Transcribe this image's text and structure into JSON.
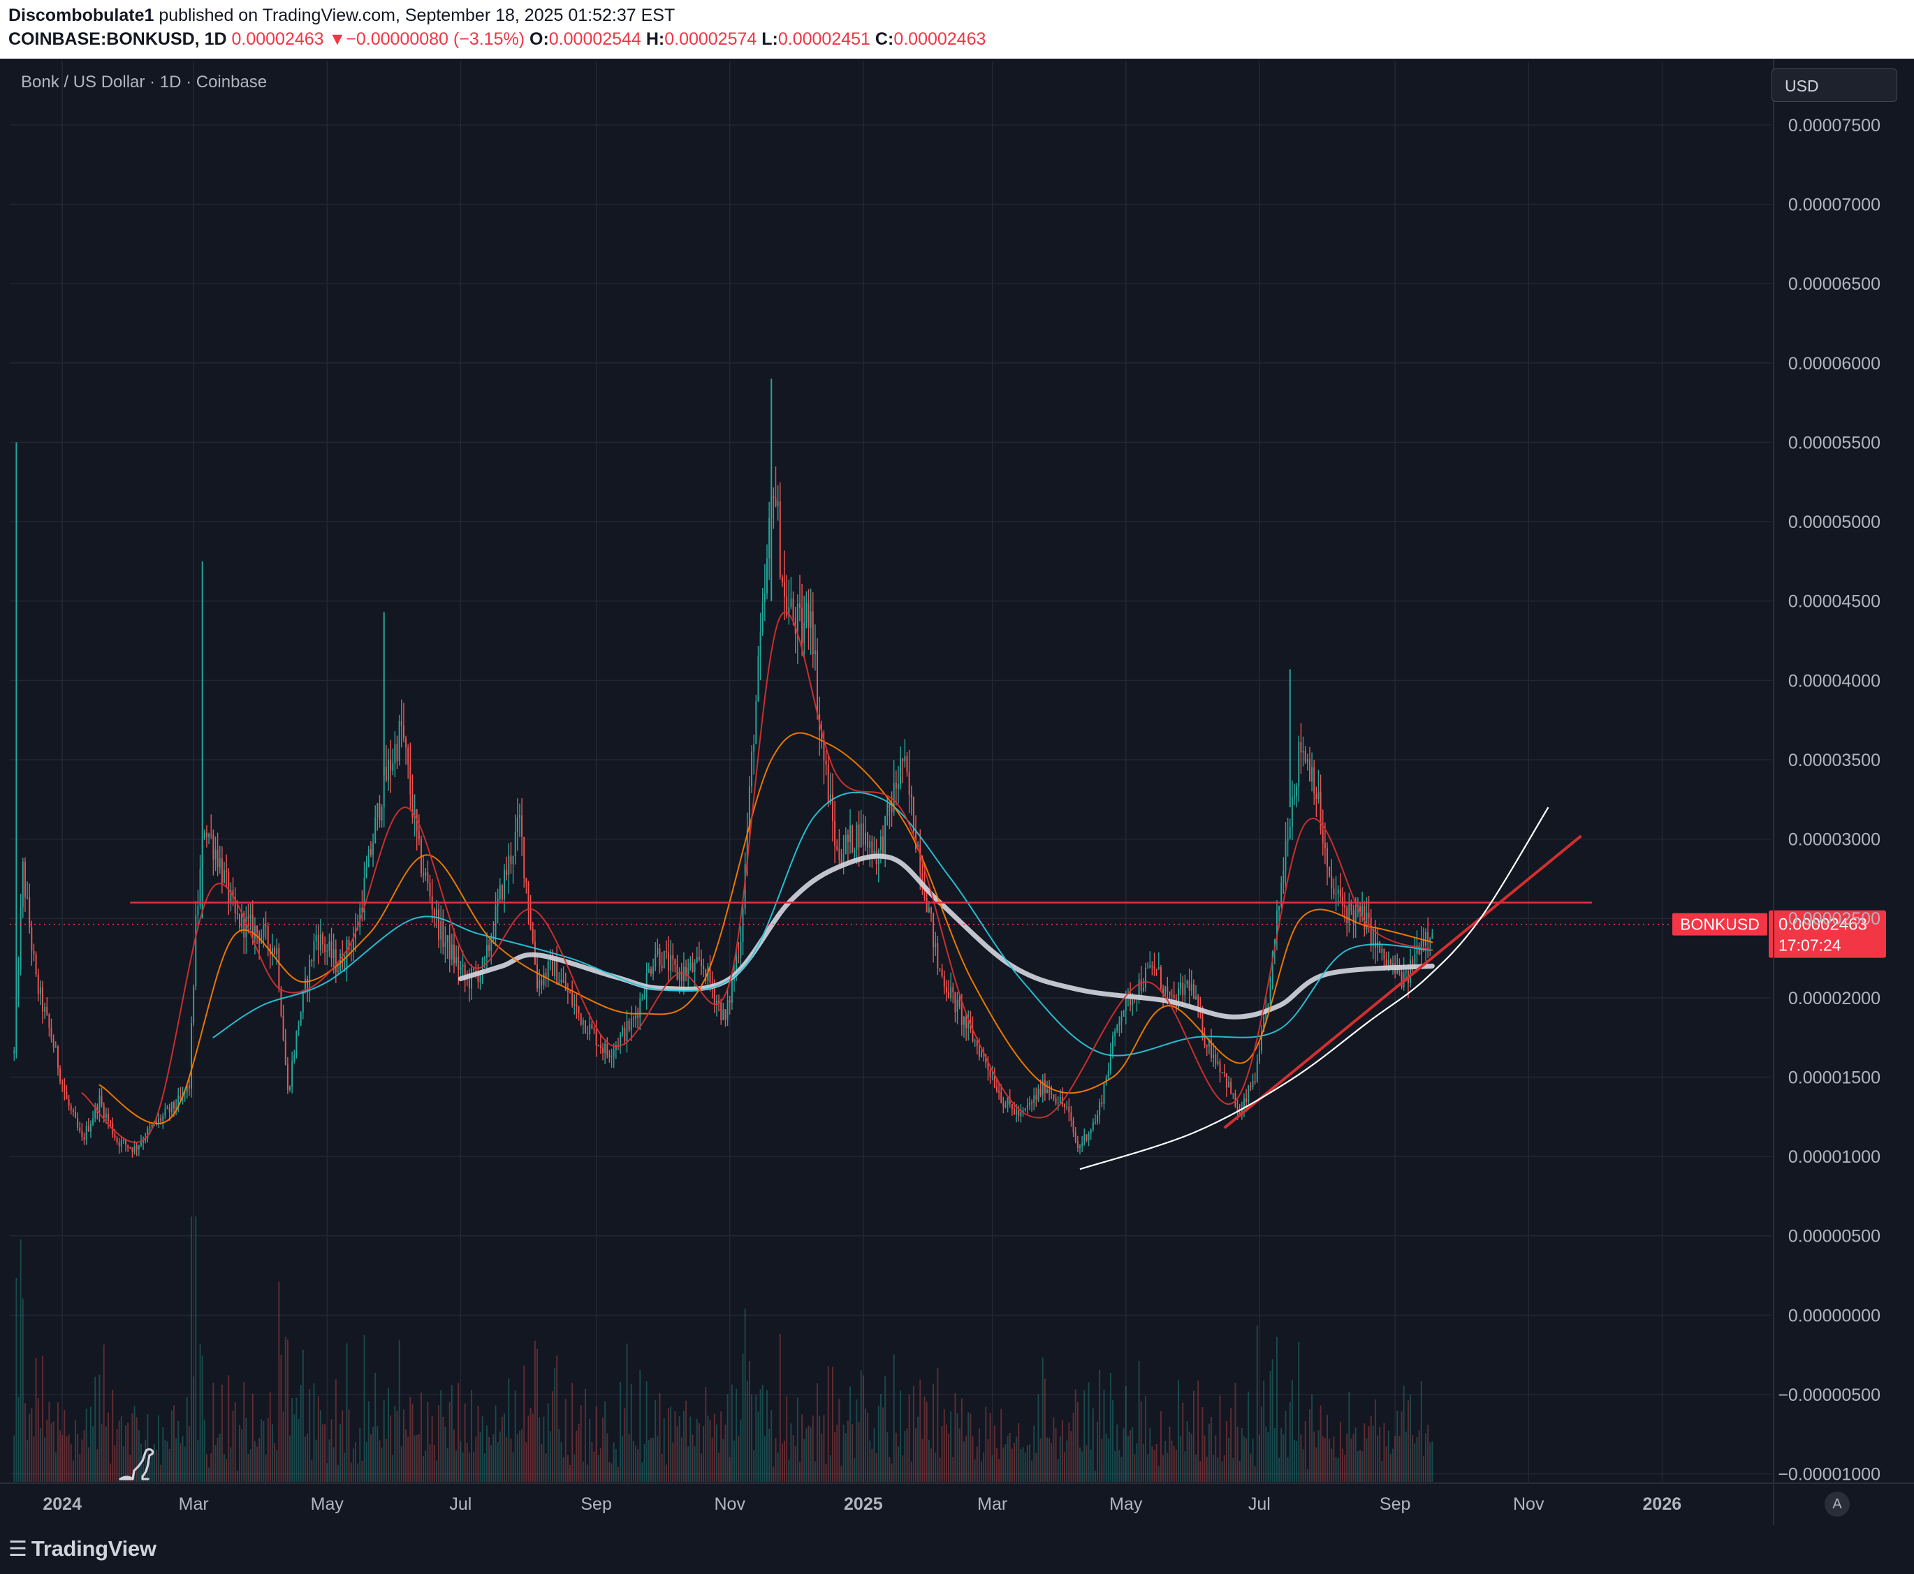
{
  "header": {
    "publisher": "Discombobulate1",
    "published_text": "published on TradingView.com, September 18, 2025 01:52:37 EST",
    "symbol": "COINBASE:BONKUSD, 1D",
    "last": "0.00002463",
    "arrow": "▼",
    "change": "−0.00000080 (−3.15%)",
    "o_label": "O:",
    "o_value": "0.00002544",
    "h_label": "H:",
    "h_value": "0.00002574",
    "l_label": "L:",
    "l_value": "0.00002451",
    "c_label": "C:",
    "c_value": "0.00002463"
  },
  "chart_title": "Bonk / US Dollar · 1D · Coinbase",
  "currency": "USD",
  "auto_button": "A",
  "brand": "TradingView",
  "colors": {
    "background": "#131722",
    "grid": "#232733",
    "up": "#26a69a",
    "down": "#ef5350",
    "resistance": "#e0323f",
    "ma_long": "#d1d4dc",
    "ma_teal": "#26c6da",
    "ma_orange": "#f57c00",
    "ma_red": "#d32f2f",
    "price_label": "#f23645"
  },
  "chart_data": {
    "type": "candlestick",
    "x_axis": {
      "range": [
        "2023-12-08",
        "2026-02-20"
      ],
      "ticks": [
        {
          "label": "2024",
          "date": "2024-01-01",
          "bold": true
        },
        {
          "label": "Mar",
          "date": "2024-03-01"
        },
        {
          "label": "May",
          "date": "2024-05-01"
        },
        {
          "label": "Jul",
          "date": "2024-07-01"
        },
        {
          "label": "Sep",
          "date": "2024-09-01"
        },
        {
          "label": "Nov",
          "date": "2024-11-01"
        },
        {
          "label": "2025",
          "date": "2025-01-01",
          "bold": true
        },
        {
          "label": "Mar",
          "date": "2025-03-01"
        },
        {
          "label": "May",
          "date": "2025-05-01"
        },
        {
          "label": "Jul",
          "date": "2025-07-01"
        },
        {
          "label": "Sep",
          "date": "2025-09-01"
        },
        {
          "label": "Nov",
          "date": "2025-11-01"
        },
        {
          "label": "2026",
          "date": "2026-01-01",
          "bold": true
        }
      ]
    },
    "y_axis": {
      "range": [
        -1.05e-05,
        7.9e-05
      ],
      "ticks": [
        {
          "value": 7.5e-05,
          "label": "0.00007500"
        },
        {
          "value": 7e-05,
          "label": "0.00007000"
        },
        {
          "value": 6.5e-05,
          "label": "0.00006500"
        },
        {
          "value": 6e-05,
          "label": "0.00006000"
        },
        {
          "value": 5.5e-05,
          "label": "0.00005500"
        },
        {
          "value": 5e-05,
          "label": "0.00005000"
        },
        {
          "value": 4.5e-05,
          "label": "0.00004500"
        },
        {
          "value": 4e-05,
          "label": "0.00004000"
        },
        {
          "value": 3.5e-05,
          "label": "0.00003500"
        },
        {
          "value": 3e-05,
          "label": "0.00003000"
        },
        {
          "value": 2.5e-05,
          "label": "0.00002500"
        },
        {
          "value": 2e-05,
          "label": "0.00002000"
        },
        {
          "value": 1.5e-05,
          "label": "0.00001500"
        },
        {
          "value": 1e-05,
          "label": "0.00001000"
        },
        {
          "value": 5e-06,
          "label": "0.00000500"
        },
        {
          "value": 0,
          "label": "0.00000000"
        },
        {
          "value": -5e-06,
          "label": "−0.00000500"
        },
        {
          "value": -1e-05,
          "label": "−0.00001000"
        }
      ]
    },
    "grid": true,
    "price_keypoints": [
      [
        "2023-12-10",
        1.65e-05
      ],
      [
        "2023-12-14",
        2.8e-05
      ],
      [
        "2023-12-20",
        2.1e-05
      ],
      [
        "2023-12-28",
        1.7e-05
      ],
      [
        "2024-01-03",
        1.35e-05
      ],
      [
        "2024-01-10",
        1.1e-05
      ],
      [
        "2024-01-18",
        1.35e-05
      ],
      [
        "2024-01-26",
        1.1e-05
      ],
      [
        "2024-02-03",
        1.05e-05
      ],
      [
        "2024-02-12",
        1.2e-05
      ],
      [
        "2024-02-24",
        1.35e-05
      ],
      [
        "2024-02-28",
        1.45e-05
      ],
      [
        "2024-03-02",
        2.45e-05
      ],
      [
        "2024-03-06",
        3.1e-05
      ],
      [
        "2024-03-12",
        2.9e-05
      ],
      [
        "2024-03-20",
        2.5e-05
      ],
      [
        "2024-04-01",
        2.4e-05
      ],
      [
        "2024-04-08",
        2.3e-05
      ],
      [
        "2024-04-13",
        1.4e-05
      ],
      [
        "2024-04-18",
        1.85e-05
      ],
      [
        "2024-04-26",
        2.4e-05
      ],
      [
        "2024-05-06",
        2.2e-05
      ],
      [
        "2024-05-14",
        2.4e-05
      ],
      [
        "2024-05-26",
        3.3e-05
      ],
      [
        "2024-06-04",
        3.7e-05
      ],
      [
        "2024-06-12",
        2.9e-05
      ],
      [
        "2024-06-22",
        2.4e-05
      ],
      [
        "2024-07-04",
        2.1e-05
      ],
      [
        "2024-07-12",
        2.2e-05
      ],
      [
        "2024-07-20",
        2.7e-05
      ],
      [
        "2024-07-28",
        3.1e-05
      ],
      [
        "2024-08-05",
        2.1e-05
      ],
      [
        "2024-08-12",
        2.2e-05
      ],
      [
        "2024-08-24",
        1.9e-05
      ],
      [
        "2024-09-06",
        1.65e-05
      ],
      [
        "2024-09-18",
        1.85e-05
      ],
      [
        "2024-09-28",
        2.3e-05
      ],
      [
        "2024-10-08",
        2.15e-05
      ],
      [
        "2024-10-20",
        2.2e-05
      ],
      [
        "2024-10-30",
        1.85e-05
      ],
      [
        "2024-11-06",
        2.4e-05
      ],
      [
        "2024-11-12",
        3.7e-05
      ],
      [
        "2024-11-18",
        4.7e-05
      ],
      [
        "2024-11-21",
        5.3e-05
      ],
      [
        "2024-11-26",
        4.5e-05
      ],
      [
        "2024-12-04",
        4.3e-05
      ],
      [
        "2024-12-08",
        4.5e-05
      ],
      [
        "2024-12-12",
        3.7e-05
      ],
      [
        "2024-12-20",
        2.9e-05
      ],
      [
        "2024-12-30",
        3.05e-05
      ],
      [
        "2025-01-08",
        2.9e-05
      ],
      [
        "2025-01-19",
        3.5e-05
      ],
      [
        "2025-01-28",
        2.8e-05
      ],
      [
        "2025-02-04",
        2.2e-05
      ],
      [
        "2025-02-14",
        1.9e-05
      ],
      [
        "2025-02-26",
        1.6e-05
      ],
      [
        "2025-03-06",
        1.35e-05
      ],
      [
        "2025-03-14",
        1.25e-05
      ],
      [
        "2025-03-25",
        1.45e-05
      ],
      [
        "2025-04-04",
        1.3e-05
      ],
      [
        "2025-04-09",
        1.05e-05
      ],
      [
        "2025-04-18",
        1.25e-05
      ],
      [
        "2025-04-28",
        1.9e-05
      ],
      [
        "2025-05-08",
        2.1e-05
      ],
      [
        "2025-05-14",
        2.2e-05
      ],
      [
        "2025-05-22",
        1.95e-05
      ],
      [
        "2025-05-30",
        2.1e-05
      ],
      [
        "2025-06-06",
        1.75e-05
      ],
      [
        "2025-06-14",
        1.55e-05
      ],
      [
        "2025-06-22",
        1.25e-05
      ],
      [
        "2025-06-30",
        1.55e-05
      ],
      [
        "2025-07-06",
        2.1e-05
      ],
      [
        "2025-07-14",
        3.1e-05
      ],
      [
        "2025-07-20",
        3.6e-05
      ],
      [
        "2025-07-26",
        3.4e-05
      ],
      [
        "2025-08-02",
        2.7e-05
      ],
      [
        "2025-08-10",
        2.55e-05
      ],
      [
        "2025-08-18",
        2.5e-05
      ],
      [
        "2025-08-26",
        2.25e-05
      ],
      [
        "2025-09-06",
        2.1e-05
      ],
      [
        "2025-09-12",
        2.35e-05
      ],
      [
        "2025-09-18",
        2.463e-05
      ]
    ],
    "indicators": [
      {
        "kind": "moving-average",
        "color": "#d1d4dc",
        "points": [
          [
            "2024-07-01",
            2.12e-05
          ],
          [
            "2024-07-20",
            2.2e-05
          ],
          [
            "2024-08-05",
            2.27e-05
          ],
          [
            "2024-09-10",
            2.13e-05
          ],
          [
            "2024-10-01",
            2.06e-05
          ],
          [
            "2024-11-01",
            2.12e-05
          ],
          [
            "2024-11-28",
            2.6e-05
          ],
          [
            "2024-12-20",
            2.82e-05
          ],
          [
            "2025-01-14",
            2.88e-05
          ],
          [
            "2025-02-05",
            2.6e-05
          ],
          [
            "2025-03-10",
            2.2e-05
          ],
          [
            "2025-04-10",
            2.05e-05
          ],
          [
            "2025-05-20",
            1.98e-05
          ],
          [
            "2025-06-18",
            1.88e-05
          ],
          [
            "2025-07-10",
            1.95e-05
          ],
          [
            "2025-08-01",
            2.15e-05
          ],
          [
            "2025-09-18",
            2.2e-05
          ]
        ]
      },
      {
        "kind": "moving-average",
        "color": "#26c6da",
        "points": [
          [
            "2024-03-10",
            1.75e-05
          ],
          [
            "2024-04-01",
            1.95e-05
          ],
          [
            "2024-05-01",
            2.1e-05
          ],
          [
            "2024-06-10",
            2.5e-05
          ],
          [
            "2024-07-10",
            2.4e-05
          ],
          [
            "2024-08-20",
            2.25e-05
          ],
          [
            "2024-10-01",
            2.05e-05
          ],
          [
            "2024-11-08",
            2.2e-05
          ],
          [
            "2024-12-10",
            3.15e-05
          ],
          [
            "2025-01-10",
            3.25e-05
          ],
          [
            "2025-02-10",
            2.75e-05
          ],
          [
            "2025-03-15",
            2.1e-05
          ],
          [
            "2025-04-20",
            1.65e-05
          ],
          [
            "2025-06-01",
            1.75e-05
          ],
          [
            "2025-07-10",
            1.8e-05
          ],
          [
            "2025-08-10",
            2.3e-05
          ],
          [
            "2025-09-18",
            2.3e-05
          ]
        ]
      },
      {
        "kind": "moving-average",
        "color": "#f57c00",
        "points": [
          [
            "2024-01-18",
            1.45e-05
          ],
          [
            "2024-02-20",
            1.25e-05
          ],
          [
            "2024-03-20",
            2.4e-05
          ],
          [
            "2024-04-20",
            2.1e-05
          ],
          [
            "2024-05-20",
            2.4e-05
          ],
          [
            "2024-06-16",
            2.9e-05
          ],
          [
            "2024-07-16",
            2.35e-05
          ],
          [
            "2024-08-20",
            2.05e-05
          ],
          [
            "2024-09-20",
            1.9e-05
          ],
          [
            "2024-10-20",
            2.1e-05
          ],
          [
            "2024-11-20",
            3.5e-05
          ],
          [
            "2024-12-16",
            3.6e-05
          ],
          [
            "2025-01-20",
            3.1e-05
          ],
          [
            "2025-02-20",
            2.1e-05
          ],
          [
            "2025-03-25",
            1.45e-05
          ],
          [
            "2025-04-25",
            1.5e-05
          ],
          [
            "2025-05-20",
            1.95e-05
          ],
          [
            "2025-06-25",
            1.6e-05
          ],
          [
            "2025-07-20",
            2.5e-05
          ],
          [
            "2025-08-20",
            2.45e-05
          ],
          [
            "2025-09-18",
            2.35e-05
          ]
        ]
      },
      {
        "kind": "moving-average",
        "color": "#d32f2f",
        "points": [
          [
            "2024-01-10",
            1.4e-05
          ],
          [
            "2024-02-10",
            1.15e-05
          ],
          [
            "2024-03-10",
            2.7e-05
          ],
          [
            "2024-04-10",
            2.05e-05
          ],
          [
            "2024-05-10",
            2.3e-05
          ],
          [
            "2024-06-06",
            3.2e-05
          ],
          [
            "2024-07-06",
            2.2e-05
          ],
          [
            "2024-08-04",
            2.55e-05
          ],
          [
            "2024-09-08",
            1.7e-05
          ],
          [
            "2024-10-08",
            2.15e-05
          ],
          [
            "2024-11-01",
            2.1e-05
          ],
          [
            "2024-11-24",
            4.4e-05
          ],
          [
            "2024-12-20",
            3.4e-05
          ],
          [
            "2025-01-20",
            3.15e-05
          ],
          [
            "2025-02-20",
            1.8e-05
          ],
          [
            "2025-03-25",
            1.25e-05
          ],
          [
            "2025-05-10",
            2.1e-05
          ],
          [
            "2025-06-20",
            1.35e-05
          ],
          [
            "2025-07-22",
            3.1e-05
          ],
          [
            "2025-08-20",
            2.45e-05
          ],
          [
            "2025-09-18",
            2.3e-05
          ]
        ]
      }
    ],
    "drawings": [
      {
        "kind": "horizontal-line",
        "color": "#e0323f",
        "from": "2024-02-01",
        "to": "2025-11-30",
        "value": 2.6e-05
      },
      {
        "kind": "trendline",
        "color": "#d32f2f",
        "from": [
          "2025-06-15",
          1.18e-05
        ],
        "to": [
          "2025-11-25",
          3.02e-05
        ]
      },
      {
        "kind": "parabolic-curve",
        "color": "#ffffff",
        "points": [
          [
            "2025-04-10",
            9.2e-06
          ],
          [
            "2025-06-01",
            1.15e-05
          ],
          [
            "2025-07-15",
            1.48e-05
          ],
          [
            "2025-08-20",
            1.85e-05
          ],
          [
            "2025-09-15",
            2.12e-05
          ],
          [
            "2025-10-10",
            2.5e-05
          ],
          [
            "2025-11-10",
            3.2e-05
          ]
        ]
      }
    ],
    "current_price": {
      "symbol": "BONKUSD",
      "value": 2.463e-05,
      "label": "0.00002463",
      "countdown": "17:07:24"
    },
    "volume": {
      "kind": "histogram",
      "note": "per-bar volume histogram along the bottom of the pane"
    }
  }
}
